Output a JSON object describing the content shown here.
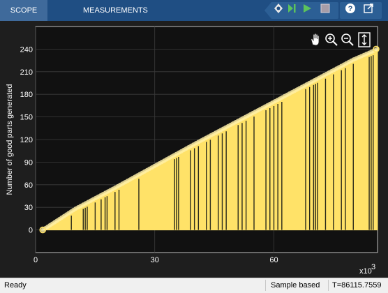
{
  "toolstrip": {
    "tabs": [
      "SCOPE",
      "MEASUREMENTS"
    ],
    "icons": [
      "highlight-block-icon",
      "step-forward-icon",
      "run-icon",
      "stop-icon",
      "help-icon",
      "undock-icon"
    ]
  },
  "plot_tools": [
    "pan-hand-icon",
    "zoom-in-icon",
    "zoom-out-icon",
    "autoscale-icon"
  ],
  "colors": {
    "signal": "#ffe268",
    "axes_bg": "#111111",
    "grid": "#3c3c3c",
    "toolstrip": "#1f4e83"
  },
  "chart_data": {
    "type": "area",
    "title": "",
    "xlabel": "",
    "ylabel": "Number of good parts generated",
    "x_exponent_label": "x10",
    "x_exponent_sup": "3",
    "xlim": [
      0,
      86.1
    ],
    "ylim": [
      -30,
      270
    ],
    "xticks": [
      "0",
      "30",
      "60"
    ],
    "xtick_values": [
      0,
      30,
      60
    ],
    "yticks": [
      "0",
      "30",
      "60",
      "90",
      "120",
      "150",
      "180",
      "210",
      "240"
    ],
    "ytick_values": [
      0,
      30,
      60,
      90,
      120,
      150,
      180,
      210,
      240
    ],
    "grid": true,
    "series": [
      {
        "x": [
          1.8,
          10,
          20,
          30,
          40,
          50,
          60,
          70,
          80,
          86.1
        ],
        "y": [
          0,
          28,
          56,
          85,
          114,
          142,
          170,
          198,
          226,
          240
        ]
      }
    ],
    "drop_x": [
      9,
      12,
      12.5,
      13,
      15,
      16.5,
      17.5,
      18,
      20,
      21,
      26,
      35,
      35.5,
      36,
      39,
      40,
      41,
      43,
      44,
      46,
      47,
      48,
      51,
      52,
      53,
      55,
      58,
      59,
      60,
      61,
      62,
      68,
      69,
      70,
      70.5,
      71,
      73,
      75,
      77,
      78,
      80,
      84,
      84.5,
      85
    ]
  },
  "status": {
    "ready": "Ready",
    "mode": "Sample based",
    "time": "T=86115.7559"
  }
}
